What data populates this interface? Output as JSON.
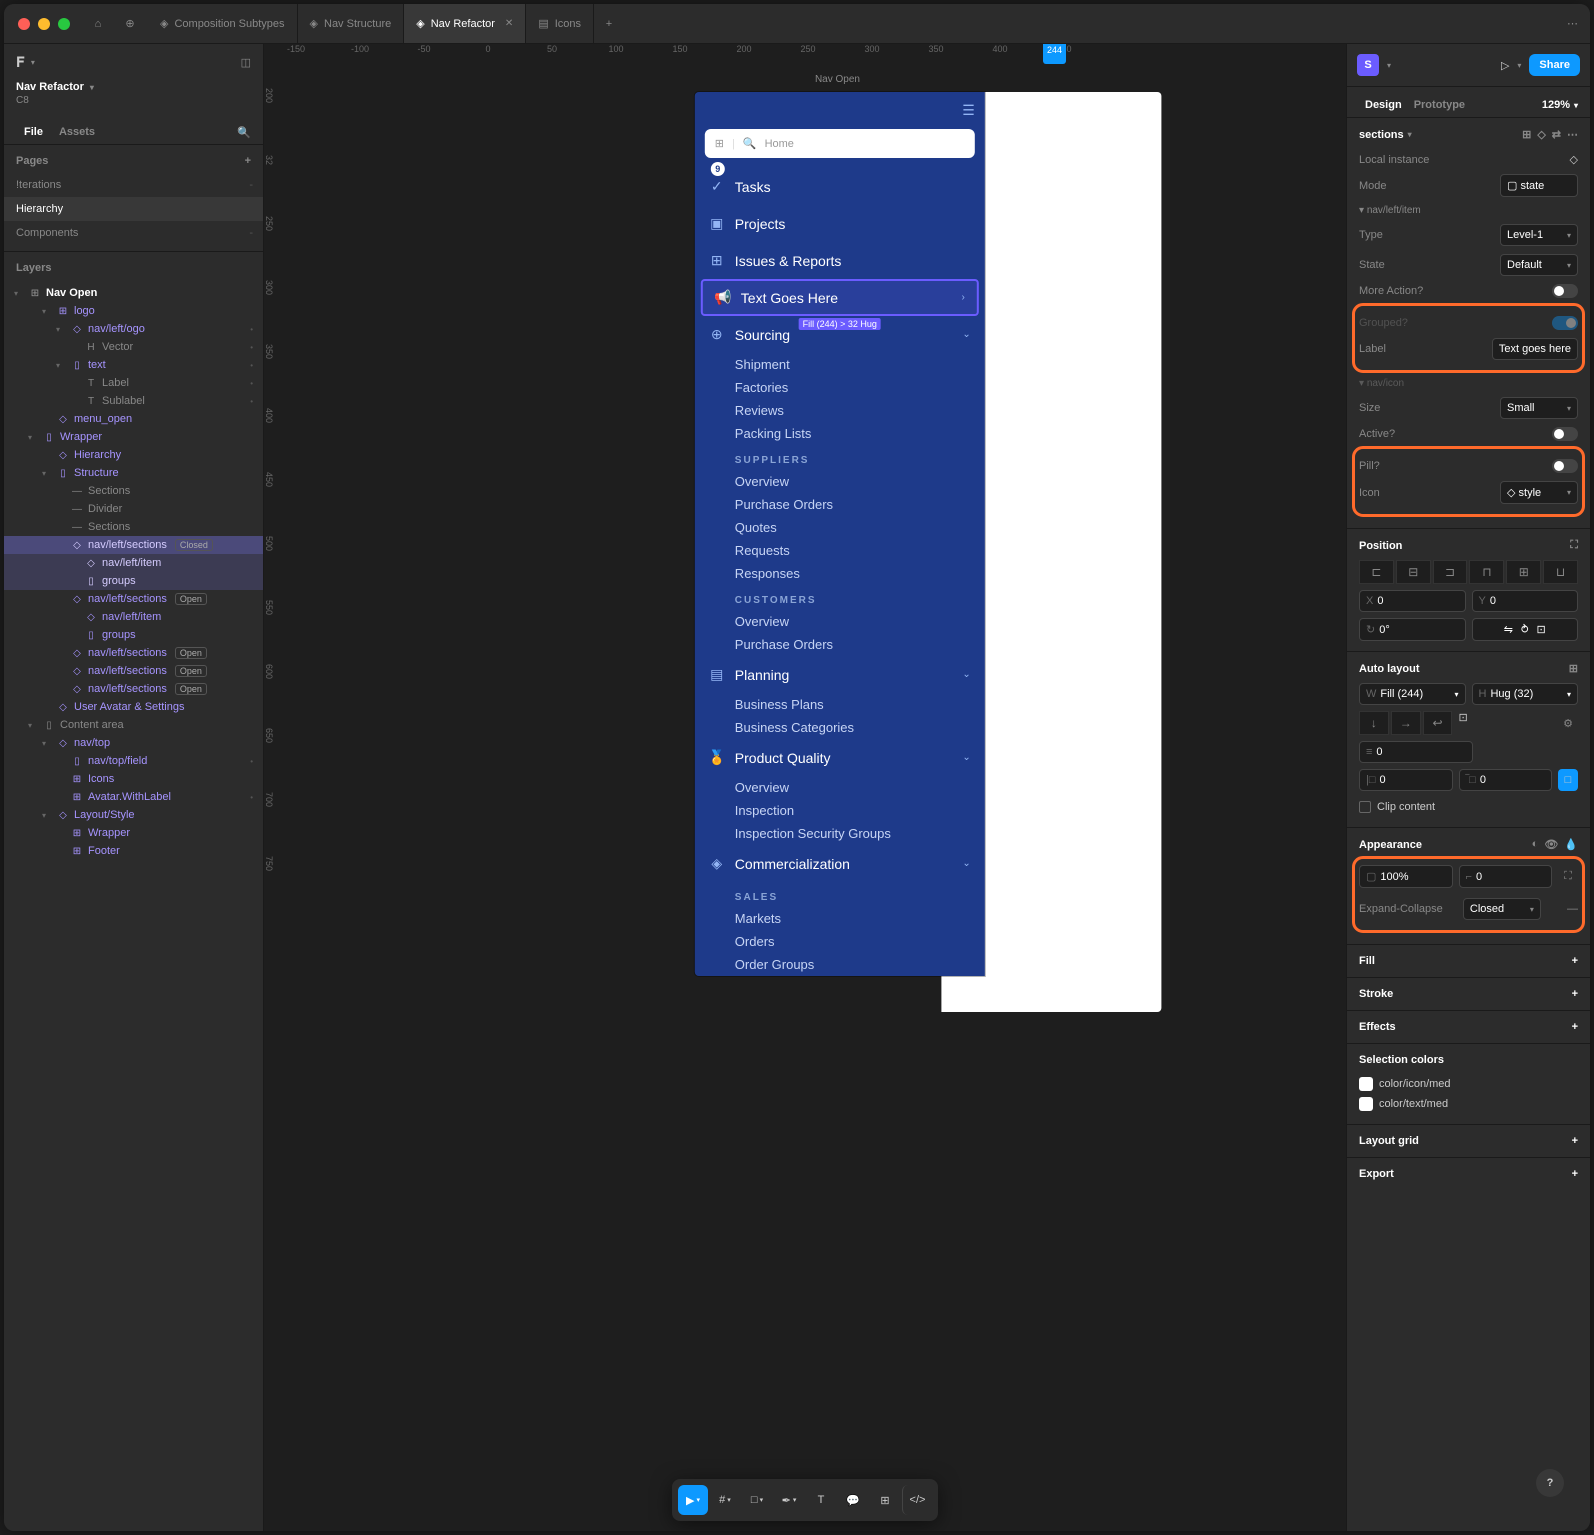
{
  "titlebar": {
    "tabs": [
      {
        "icon": "component",
        "label": "Composition Subtypes"
      },
      {
        "icon": "component",
        "label": "Nav Structure"
      },
      {
        "icon": "component",
        "label": "Nav Refactor",
        "active": true,
        "closable": true
      },
      {
        "icon": "book",
        "label": "Icons"
      }
    ]
  },
  "left": {
    "title": "Nav Refactor",
    "subtitle": "C8",
    "tabs": [
      "File",
      "Assets"
    ],
    "activeTab": "File",
    "pagesHeader": "Pages",
    "pages": [
      {
        "label": "!terations"
      },
      {
        "label": "Hierarchy",
        "selected": true
      },
      {
        "label": "Components"
      }
    ],
    "layersHeader": "Layers",
    "layers": [
      {
        "indent": 0,
        "icon": "frame",
        "label": "Nav Open",
        "bold": true,
        "chev": "down"
      },
      {
        "indent": 2,
        "icon": "frame",
        "label": "logo",
        "purple": true,
        "chev": "down"
      },
      {
        "indent": 3,
        "icon": "diamond",
        "label": "nav/left/ogo",
        "purple": true,
        "chev": "down",
        "lock": true
      },
      {
        "indent": 4,
        "icon": "H",
        "label": "Vector",
        "dim": true,
        "lock": true
      },
      {
        "indent": 3,
        "icon": "frame-sm",
        "label": "text",
        "purple": true,
        "chev": "down",
        "lock": true
      },
      {
        "indent": 4,
        "icon": "T",
        "label": "Label",
        "dim": true,
        "lock": true
      },
      {
        "indent": 4,
        "icon": "T",
        "label": "Sublabel",
        "dim": true,
        "lock": true
      },
      {
        "indent": 2,
        "icon": "diamond",
        "label": "menu_open",
        "purple": true
      },
      {
        "indent": 1,
        "icon": "frame-sm",
        "label": "Wrapper",
        "purple": true,
        "chev": "down"
      },
      {
        "indent": 2,
        "icon": "diamond",
        "label": "Hierarchy",
        "purple": true
      },
      {
        "indent": 2,
        "icon": "frame-sm",
        "label": "Structure",
        "purple": true,
        "chev": "down"
      },
      {
        "indent": 3,
        "icon": "—",
        "label": "Sections",
        "dim": true
      },
      {
        "indent": 3,
        "icon": "—",
        "label": "Divider",
        "dim": true
      },
      {
        "indent": 3,
        "icon": "—",
        "label": "Sections",
        "dim": true
      },
      {
        "indent": 3,
        "icon": "diamond",
        "label": "nav/left/sections",
        "highlight": true,
        "badge": "Closed"
      },
      {
        "indent": 4,
        "icon": "diamond",
        "label": "nav/left/item",
        "highlightLight": true
      },
      {
        "indent": 4,
        "icon": "frame-sm",
        "label": "groups",
        "highlightLight": true
      },
      {
        "indent": 3,
        "icon": "diamond",
        "label": "nav/left/sections",
        "purple": true,
        "badge": "Open"
      },
      {
        "indent": 4,
        "icon": "diamond",
        "label": "nav/left/item",
        "purple": true
      },
      {
        "indent": 4,
        "icon": "frame-sm",
        "label": "groups",
        "purple": true
      },
      {
        "indent": 3,
        "icon": "diamond",
        "label": "nav/left/sections",
        "purple": true,
        "badge": "Open"
      },
      {
        "indent": 3,
        "icon": "diamond",
        "label": "nav/left/sections",
        "purple": true,
        "badge": "Open"
      },
      {
        "indent": 3,
        "icon": "diamond",
        "label": "nav/left/sections",
        "purple": true,
        "badge": "Open"
      },
      {
        "indent": 2,
        "icon": "diamond",
        "label": "User Avatar & Settings",
        "purple": true
      },
      {
        "indent": 1,
        "icon": "frame-sm",
        "label": "Content area",
        "dim": true,
        "chev": "down"
      },
      {
        "indent": 2,
        "icon": "diamond",
        "label": "nav/top",
        "purple": true,
        "chev": "down"
      },
      {
        "indent": 3,
        "icon": "frame-sm",
        "label": "nav/top/field",
        "purple": true,
        "lock": true
      },
      {
        "indent": 3,
        "icon": "frame",
        "label": "Icons",
        "purple": true
      },
      {
        "indent": 3,
        "icon": "frame",
        "label": "Avatar.WithLabel",
        "purple": true,
        "lock": true
      },
      {
        "indent": 2,
        "icon": "diamond",
        "label": "Layout/Style",
        "purple": true,
        "chev": "down"
      },
      {
        "indent": 3,
        "icon": "frame",
        "label": "Wrapper",
        "purple": true
      },
      {
        "indent": 3,
        "icon": "frame",
        "label": "Footer",
        "purple": true
      }
    ]
  },
  "canvas": {
    "frameLabel": "Nav Open",
    "rulerMarker": "244",
    "rulerTicks": [
      "-150",
      "-100",
      "-50",
      "0",
      "50",
      "100",
      "150",
      "200",
      "250",
      "300",
      "350",
      "400",
      "450"
    ],
    "rulerLeftTicks": [
      "200",
      "32",
      "250",
      "300",
      "350",
      "400",
      "450",
      "500",
      "550",
      "600",
      "650",
      "700",
      "750"
    ],
    "searchPlaceholder": "Home",
    "dimLabel": "Fill (244) > 32 Hug",
    "nav": [
      {
        "type": "item",
        "icon": "check-circle",
        "label": "Tasks",
        "pill": "9"
      },
      {
        "type": "item",
        "icon": "folder",
        "label": "Projects"
      },
      {
        "type": "item",
        "icon": "chart",
        "label": "Issues & Reports"
      },
      {
        "type": "item",
        "icon": "megaphone",
        "label": "Text Goes Here",
        "selected": true,
        "chevron": true
      },
      {
        "type": "item",
        "icon": "globe",
        "label": "Sourcing",
        "chevron": "down"
      },
      {
        "type": "sub",
        "label": "Shipment"
      },
      {
        "type": "sub",
        "label": "Factories"
      },
      {
        "type": "sub",
        "label": "Reviews"
      },
      {
        "type": "sub",
        "label": "Packing Lists"
      },
      {
        "type": "header",
        "label": "SUPPLIERS"
      },
      {
        "type": "sub",
        "label": "Overview"
      },
      {
        "type": "sub",
        "label": "Purchase Orders"
      },
      {
        "type": "sub",
        "label": "Quotes"
      },
      {
        "type": "sub",
        "label": "Requests"
      },
      {
        "type": "sub",
        "label": "Responses"
      },
      {
        "type": "header",
        "label": "CUSTOMERS"
      },
      {
        "type": "sub",
        "label": "Overview"
      },
      {
        "type": "sub",
        "label": "Purchase Orders"
      },
      {
        "type": "item",
        "icon": "clipboard",
        "label": "Planning",
        "chevron": "down"
      },
      {
        "type": "sub",
        "label": "Business Plans"
      },
      {
        "type": "sub",
        "label": "Business Categories"
      },
      {
        "type": "item",
        "icon": "award",
        "label": "Product Quality",
        "chevron": "down"
      },
      {
        "type": "sub",
        "label": "Overview"
      },
      {
        "type": "sub",
        "label": "Inspection"
      },
      {
        "type": "sub",
        "label": "Inspection Security Groups"
      },
      {
        "type": "item",
        "icon": "tag",
        "label": "Commercialization",
        "chevron": "down"
      },
      {
        "type": "header",
        "label": "SALES"
      },
      {
        "type": "sub",
        "label": "Markets"
      },
      {
        "type": "sub",
        "label": "Orders"
      },
      {
        "type": "sub",
        "label": "Order Groups"
      }
    ]
  },
  "right": {
    "avatar": "S",
    "share": "Share",
    "tabs": [
      "Design",
      "Prototype"
    ],
    "activeTab": "Design",
    "zoom": "129%",
    "sectionsHeader": "sections",
    "localInstance": "Local instance",
    "component1": {
      "name": "nav/left/item",
      "mode": {
        "label": "Mode",
        "value": "state"
      },
      "type": {
        "label": "Type",
        "value": "Level-1"
      },
      "state": {
        "label": "State",
        "value": "Default"
      },
      "moreAction": {
        "label": "More Action?",
        "on": false
      },
      "grouped": {
        "label": "Grouped?",
        "on": true
      },
      "labelProp": {
        "label": "Label",
        "value": "Text goes here"
      }
    },
    "component2": {
      "name": "nav/icon",
      "size": {
        "label": "Size",
        "value": "Small"
      },
      "active": {
        "label": "Active?",
        "on": false
      },
      "pill": {
        "label": "Pill?",
        "on": false
      },
      "icon": {
        "label": "Icon",
        "value": "style"
      }
    },
    "position": {
      "header": "Position",
      "x": {
        "label": "X",
        "value": "0"
      },
      "y": {
        "label": "Y",
        "value": "0"
      },
      "rotation": {
        "label": "↻",
        "value": "0°"
      }
    },
    "autoLayout": {
      "header": "Auto layout",
      "w": {
        "label": "W",
        "value": "Fill (244)"
      },
      "h": {
        "label": "H",
        "value": "Hug (32)"
      },
      "gap": {
        "label": "≡",
        "value": "0"
      },
      "padH": {
        "label": "|□",
        "value": "0"
      },
      "padV": {
        "label": "‾□",
        "value": "0"
      },
      "clip": "Clip content"
    },
    "appearance": {
      "header": "Appearance",
      "opacity": "100%",
      "corner": "0",
      "expandLabel": "Expand-Collapse",
      "expandValue": "Closed"
    },
    "fill": "Fill",
    "stroke": "Stroke",
    "effects": "Effects",
    "selectionColors": {
      "header": "Selection colors",
      "items": [
        "color/icon/med",
        "color/text/med"
      ]
    },
    "layoutGrid": "Layout grid",
    "export": "Export"
  }
}
